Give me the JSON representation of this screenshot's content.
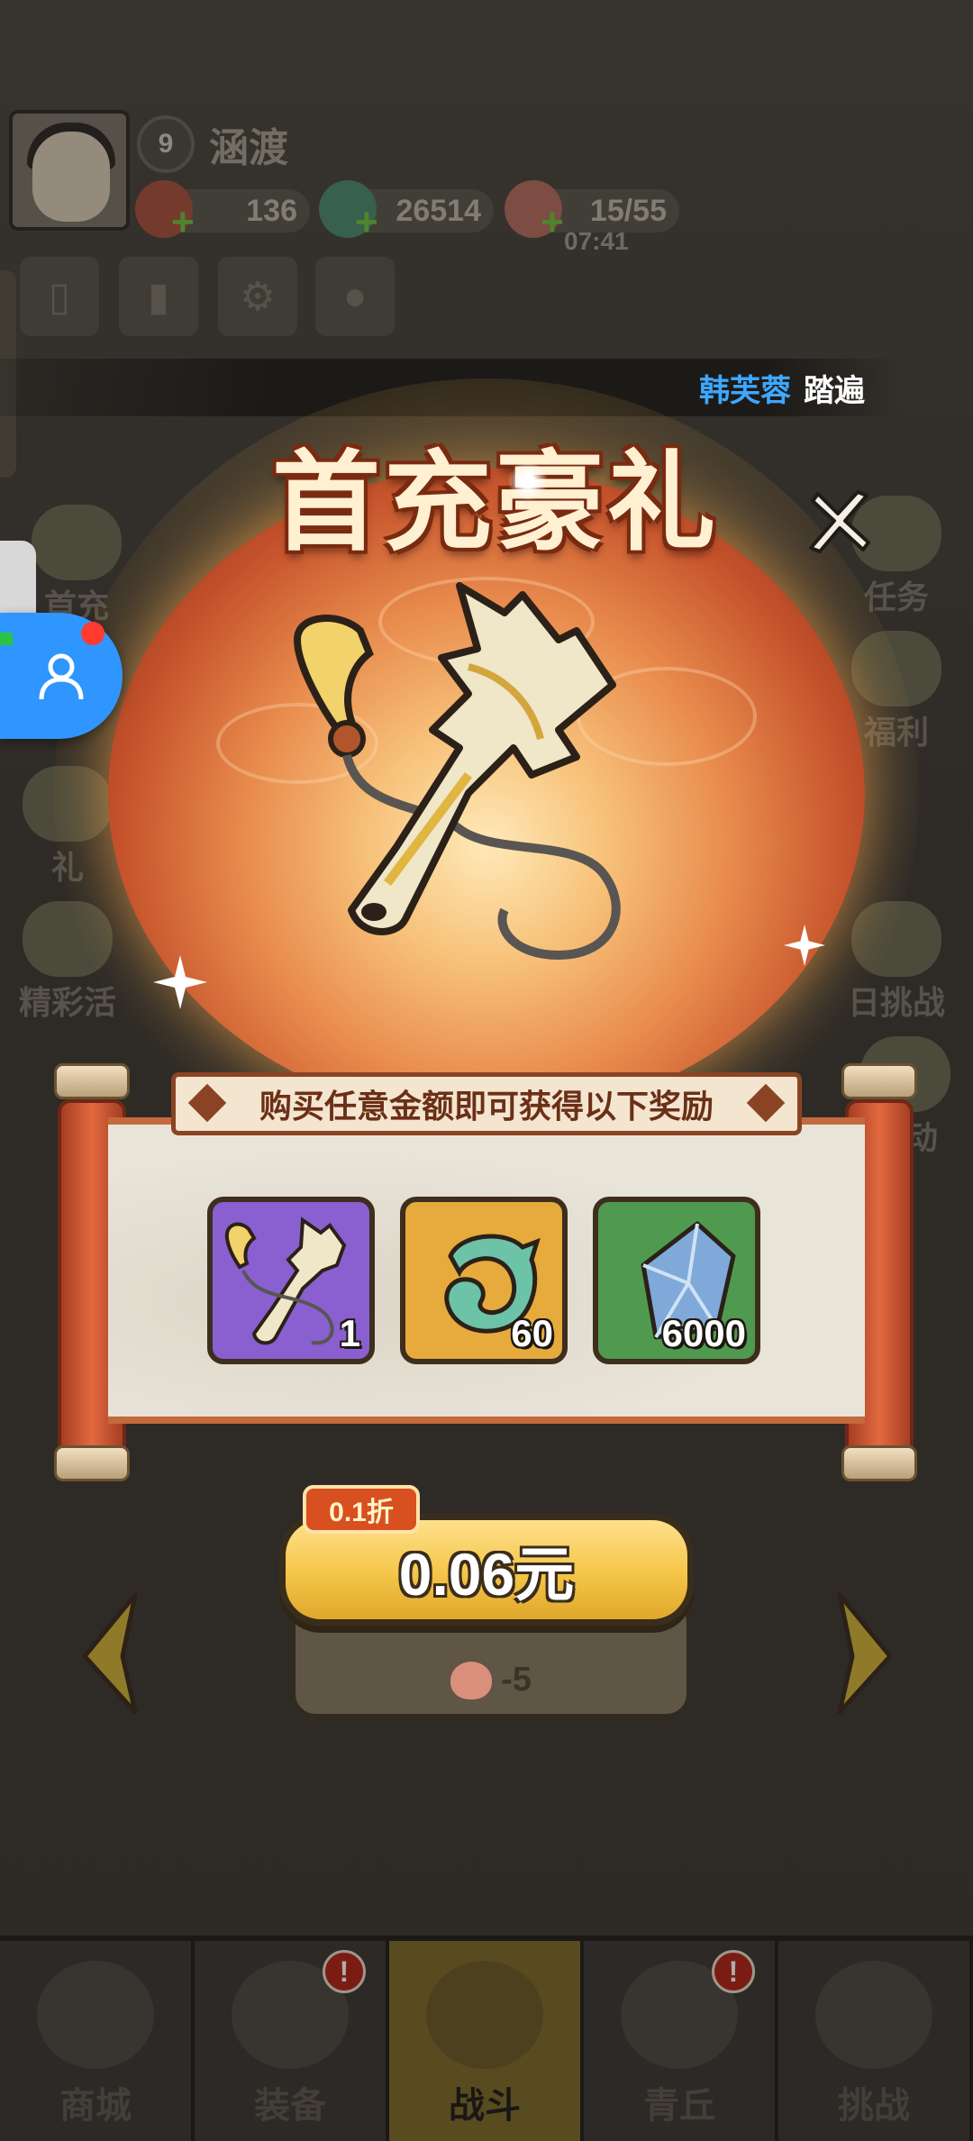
{
  "player": {
    "level": "9",
    "name": "涵渡"
  },
  "resources": {
    "coins": "136",
    "jade": "26514",
    "stamina": "15/55",
    "stamina_timer": "07:41"
  },
  "side_left": [
    {
      "label": "首充"
    },
    {
      "label": "礼"
    },
    {
      "label": "精彩活"
    }
  ],
  "side_right": [
    {
      "label": "任务"
    },
    {
      "label": "福利"
    },
    {
      "label": "日挑战"
    },
    {
      "label": "活动"
    }
  ],
  "marquee": {
    "name": "韩芙蓉",
    "text": "踏遍"
  },
  "popup": {
    "title": "首充豪礼",
    "ribbon": "购买任意金额即可获得以下奖励",
    "rewards": [
      {
        "icon": "ginkgo-pendant-icon",
        "count": "1",
        "color": "#8a5fd0"
      },
      {
        "icon": "jade-dragon-icon",
        "count": "60",
        "color": "#e6ab3c"
      },
      {
        "icon": "blue-crystal-icon",
        "count": "6000",
        "color": "#4f9a4f"
      }
    ],
    "discount": "0.1折",
    "price": "0.06元",
    "cost": "-5"
  },
  "nav": [
    {
      "label": "商城",
      "active": false,
      "alert": false
    },
    {
      "label": "装备",
      "active": false,
      "alert": true
    },
    {
      "label": "战斗",
      "active": true,
      "alert": false
    },
    {
      "label": "青丘",
      "active": false,
      "alert": true
    },
    {
      "label": "挑战",
      "active": false,
      "alert": false
    }
  ],
  "alert_glyph": "!"
}
